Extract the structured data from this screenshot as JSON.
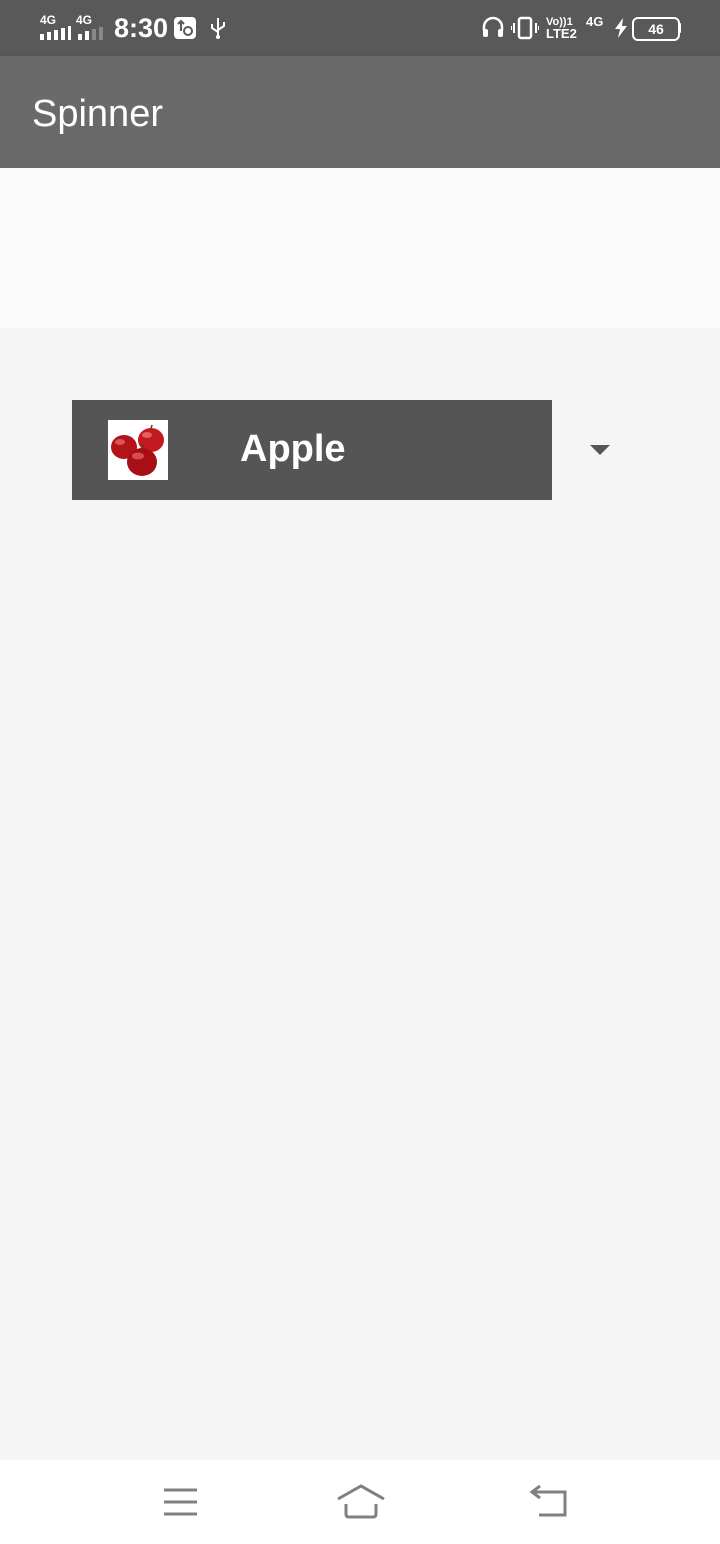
{
  "status_bar": {
    "time": "8:30",
    "sim1_label": "4G",
    "sim2_label": "4G",
    "volte_label": "Vo))1",
    "lte_label": "LTE2",
    "network_label": "4G",
    "battery_level": "46",
    "icons": [
      "signal-icon",
      "signal-icon",
      "usb-debug-icon",
      "usb-icon",
      "headset-icon",
      "vibrate-icon",
      "charging-icon",
      "battery-icon"
    ]
  },
  "app_bar": {
    "title": "Spinner"
  },
  "spinner": {
    "selected_label": "Apple",
    "selected_image": "apple-image",
    "arrow_icon": "dropdown-arrow-icon"
  },
  "nav_bar": {
    "icons": [
      "menu-icon",
      "home-icon",
      "back-icon"
    ]
  },
  "colors": {
    "status_bar": "#595959",
    "app_bar": "#6a6a6a",
    "spinner_item": "#555555",
    "background": "#f5f5f5"
  }
}
